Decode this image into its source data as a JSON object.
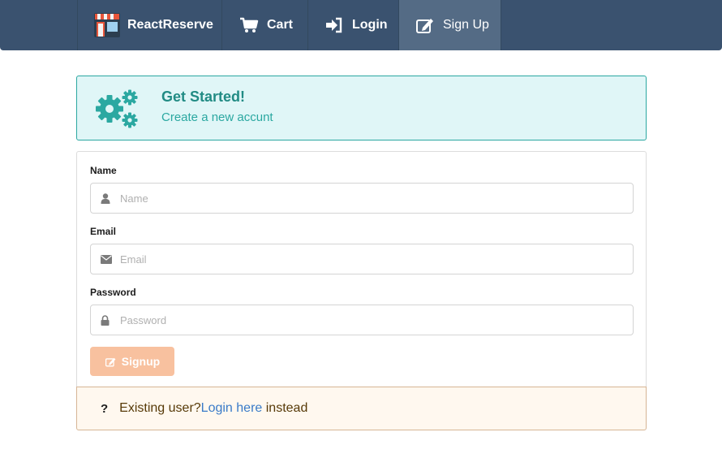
{
  "navbar": {
    "brand_label": "ReactReserve",
    "items": [
      {
        "label": "Cart",
        "icon": "cart-icon"
      },
      {
        "label": "Login",
        "icon": "login-icon"
      },
      {
        "label": "Sign Up",
        "icon": "edit-icon",
        "active": true
      }
    ]
  },
  "message": {
    "icon": "gears-icon",
    "header": "Get Started!",
    "subheader": "Create a new accunt"
  },
  "form": {
    "name": {
      "label": "Name",
      "placeholder": "Name",
      "value": "",
      "icon": "user-icon"
    },
    "email": {
      "label": "Email",
      "placeholder": "Email",
      "value": "",
      "icon": "envelope-icon"
    },
    "password": {
      "label": "Password",
      "placeholder": "Password",
      "value": "",
      "icon": "lock-icon"
    },
    "submit_label": "Signup",
    "submit_icon": "edit-icon"
  },
  "footer": {
    "icon": "help-icon",
    "icon_glyph": "?",
    "text_before": "Existing user?",
    "link_label": "Login here",
    "text_after": " instead"
  },
  "colors": {
    "navbar": "#3a526f",
    "navbar_active": "#546b85",
    "info_border": "#2ba8a1",
    "info_bg": "#e0f6f7",
    "button": "#f8c19f",
    "warning_bg": "#fff8ef",
    "link": "#3a7bc8"
  }
}
